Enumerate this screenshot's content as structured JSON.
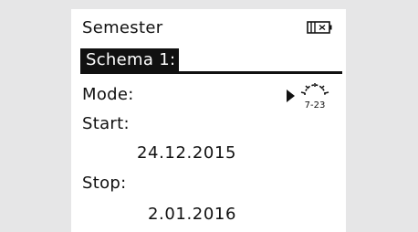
{
  "header": {
    "title": "Semester",
    "battery_icon": "battery-icon"
  },
  "schema": {
    "label": "Schema 1:"
  },
  "mode": {
    "label": "Mode:",
    "arrow_icon": "play-arrow-icon",
    "icon": "holiday-sun-icon",
    "icon_text": "7-23"
  },
  "start": {
    "label": "Start:",
    "value": "24.12.2015"
  },
  "stop": {
    "label": "Stop:",
    "value": "2.01.2016"
  },
  "colors": {
    "background": "#e6e6e7",
    "screen": "#ffffff",
    "foreground": "#111111"
  }
}
